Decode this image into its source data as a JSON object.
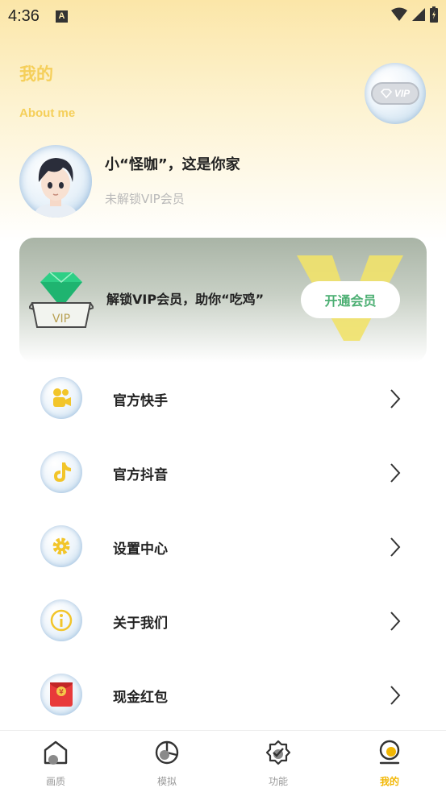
{
  "status_bar": {
    "time": "4:36",
    "notif_letter": "A"
  },
  "header": {
    "title": "我的",
    "subtitle": "About me",
    "vip_badge": "VIP"
  },
  "profile": {
    "name": "小“怪咖”，这是你家",
    "vip_status": "未解锁VIP会员"
  },
  "vip_banner": {
    "text": "解锁VIP会员，助你“吃鸡”",
    "button": "开通会员",
    "gem_label": "VIP"
  },
  "menu": [
    {
      "label": "官方快手",
      "icon": "kuaishou-icon"
    },
    {
      "label": "官方抖音",
      "icon": "douyin-icon"
    },
    {
      "label": "设置中心",
      "icon": "settings-gear-icon"
    },
    {
      "label": "关于我们",
      "icon": "info-icon"
    },
    {
      "label": "现金红包",
      "icon": "red-envelope-icon"
    }
  ],
  "tabs": [
    {
      "label": "画质",
      "icon": "quality-icon",
      "active": false
    },
    {
      "label": "模拟",
      "icon": "simulate-icon",
      "active": false
    },
    {
      "label": "功能",
      "icon": "function-icon",
      "active": false
    },
    {
      "label": "我的",
      "icon": "profile-icon",
      "active": true
    }
  ],
  "colors": {
    "accent_yellow": "#f5cf5a",
    "tab_active": "#f2b705",
    "button_green": "#4caf73"
  }
}
